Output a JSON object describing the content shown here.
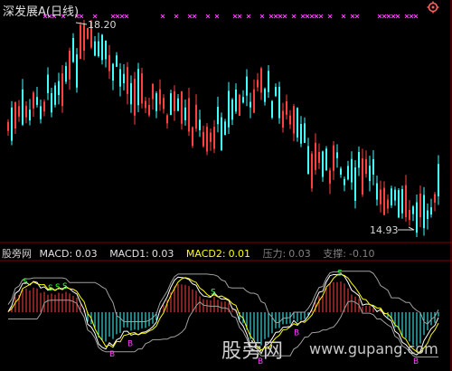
{
  "header": {
    "stock_title": "深发展A(日线)",
    "high_label": "18.20",
    "low_label": "14.93",
    "settings_icon": "gear-icon"
  },
  "indicator": {
    "name": "股旁网",
    "macd_label": "MACD:",
    "macd_value": "0.03",
    "macd1_label": "MACD1:",
    "macd1_value": "0.03",
    "macd2_label": "MACD2:",
    "macd2_value": "0.01",
    "pressure_label": "压力:",
    "pressure_value": "0.03",
    "support_label": "支撑:",
    "support_value": "-0.10"
  },
  "sub_chart": {
    "buy_marker": "B",
    "sell_marker": "S"
  },
  "footer": {
    "site_name": "股旁网",
    "site_url": "www.gupang.com"
  },
  "colors": {
    "up": "#ff4040",
    "down": "#40ffff",
    "marker": "#ff40ff",
    "macd2": "#ffff00",
    "grid": "#800000"
  },
  "chart_data": {
    "type": "candlestick",
    "max_price": 18.2,
    "min_price": 14.93
  }
}
